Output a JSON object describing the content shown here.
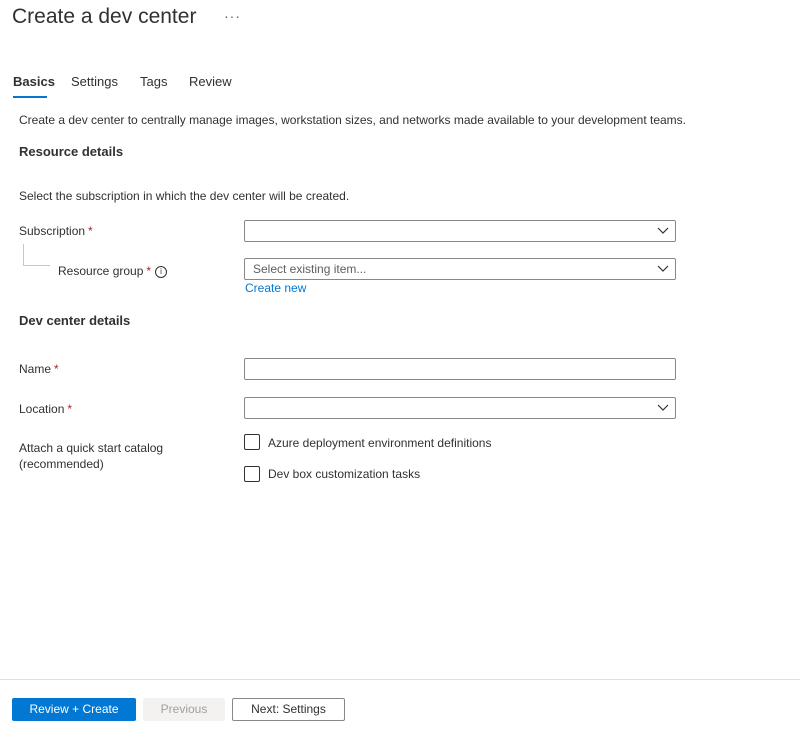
{
  "header": {
    "title": "Create a dev center",
    "more_label": "···"
  },
  "tabs": [
    {
      "label": "Basics",
      "active": true
    },
    {
      "label": "Settings",
      "active": false
    },
    {
      "label": "Tags",
      "active": false
    },
    {
      "label": "Review",
      "active": false
    }
  ],
  "intro": "Create a dev center to centrally manage images, workstation sizes, and networks made available to your development teams.",
  "resource_details": {
    "heading": "Resource details",
    "description": "Select the subscription in which the dev center will be created.",
    "subscription": {
      "label": "Subscription",
      "required": "*",
      "value": ""
    },
    "resource_group": {
      "label": "Resource group",
      "required": "*",
      "info": "i",
      "placeholder": "Select existing item...",
      "create_new": "Create new"
    }
  },
  "dev_center_details": {
    "heading": "Dev center details",
    "name": {
      "label": "Name",
      "required": "*",
      "value": ""
    },
    "location": {
      "label": "Location",
      "required": "*",
      "value": ""
    },
    "catalog": {
      "label_line1": "Attach a quick start catalog",
      "label_line2": "(recommended)",
      "options": [
        {
          "label": "Azure deployment environment definitions",
          "checked": false
        },
        {
          "label": "Dev box customization tasks",
          "checked": false
        }
      ]
    }
  },
  "footer": {
    "review_create": "Review + Create",
    "previous": "Previous",
    "next": "Next: Settings"
  },
  "colors": {
    "accent": "#0078d4",
    "required": "#a4262c",
    "border": "#8a8886"
  },
  "icons": {
    "dropdown": "chevron-down-icon",
    "info": "info-icon",
    "more": "more-icon"
  }
}
